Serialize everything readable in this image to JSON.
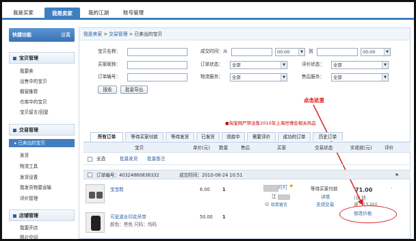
{
  "topnav": {
    "items": [
      "我是买家",
      "我是卖家",
      "我的江湖",
      "账号管理"
    ]
  },
  "sidebar": {
    "head": "快捷功能",
    "head_setting": "设置",
    "sections": [
      {
        "title": "宝贝管理",
        "items": [
          "我要卖",
          "出售中的宝贝",
          "橱窗推荐",
          "仓库中的宝贝",
          "宝贝留言/回复"
        ]
      },
      {
        "title": "交易管理",
        "items": [
          "已卖出的宝贝",
          "发货",
          "物流工具",
          "发货设置",
          "我发货物要运输",
          "评价管理"
        ]
      },
      {
        "title": "店铺管理",
        "items": [
          "我要开店",
          "图片空间"
        ]
      }
    ]
  },
  "breadcrumb": {
    "a": "我是卖家",
    "sep": " > ",
    "b": "交易管理",
    "c": "已卖出的宝贝"
  },
  "filters": {
    "item_name": "宝贝名称：",
    "buyer": "买家昵称：",
    "order_no": "订单编号：",
    "time_from": "成交时间：从",
    "to": "到",
    "order_status": "订单状态：",
    "logistics": "物流服务：",
    "review_status": "评价状态：",
    "after_sale": "售后服务：",
    "all": "全部"
  },
  "buttons": {
    "search": "搜索",
    "export": "批量导出"
  },
  "callout": "点击这里",
  "notice": "淘宝网严禁出售2010年上海世博会相关商品",
  "tabs": [
    "所有订单",
    "等待买家付款",
    "等待发货",
    "已发货",
    "退款中",
    "需要评价",
    "成功的订单",
    "历史订单"
  ],
  "columns": {
    "item": "宝贝",
    "price": "单价(元)",
    "qty": "数量",
    "after": "售后",
    "buyer": "买家",
    "status": "交易状态",
    "paid": "实收款(元)",
    "review": "评价"
  },
  "toolbar": {
    "select_all": "全选",
    "batch_ship": "批量发货",
    "batch_note": "批量备注"
  },
  "order": {
    "number": "订单编号：40324860836332",
    "time": "成交时间：2010-06-24 10:51",
    "items": [
      {
        "name": "宝宝鞋",
        "price": "6.00",
        "qty": "1",
        "spec": ""
      },
      {
        "name": "可爱淑女印花吊带",
        "price": "50.00",
        "qty": "1",
        "spec": "颜色：黑色    尺码：均码"
      }
    ],
    "buyer_nick": "叮叮",
    "buyer_real": "江",
    "contact": "给我留言",
    "status": "等待买家付款",
    "details": "详情",
    "close": "关闭交易",
    "total": "71.00",
    "shipping_note": "(含 快",
    "shipping_note2": "递：15.00)",
    "edit_price": "修改价格"
  }
}
